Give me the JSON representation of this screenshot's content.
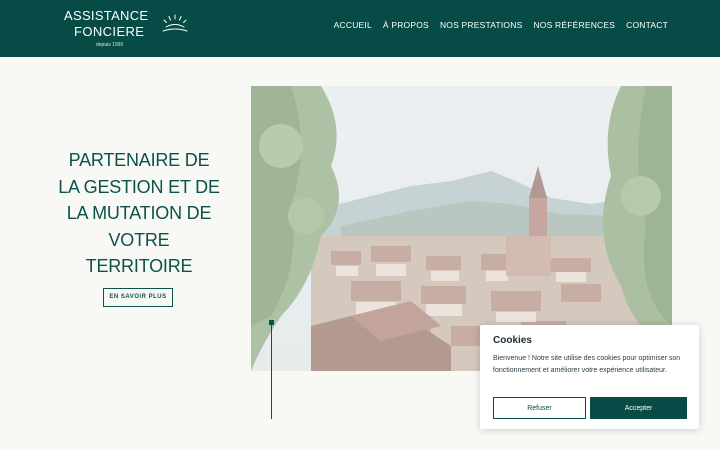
{
  "header": {
    "logo": {
      "line1": "ASSISTANCE",
      "line2": "FONCIERE",
      "since": "depuis 1990"
    },
    "nav": [
      "ACCUEIL",
      "À PROPOS",
      "NOS PRESTATIONS",
      "NOS RÉFÉRENCES",
      "CONTACT"
    ]
  },
  "hero": {
    "title": "PARTENAIRE DE LA GESTION ET DE LA MUTATION DE VOTRE TERRITOIRE",
    "cta_label": "EN SAVOIR PLUS"
  },
  "cookie": {
    "title": "Cookies",
    "text": "Bienvenue ! Notre site utilise des cookies pour optimiser son fonctionnement et améliorer votre expérience utilisateur.",
    "refuse_label": "Refuser",
    "accept_label": "Accepter"
  },
  "colors": {
    "brand": "#064b45",
    "background": "#f8f8f5"
  }
}
